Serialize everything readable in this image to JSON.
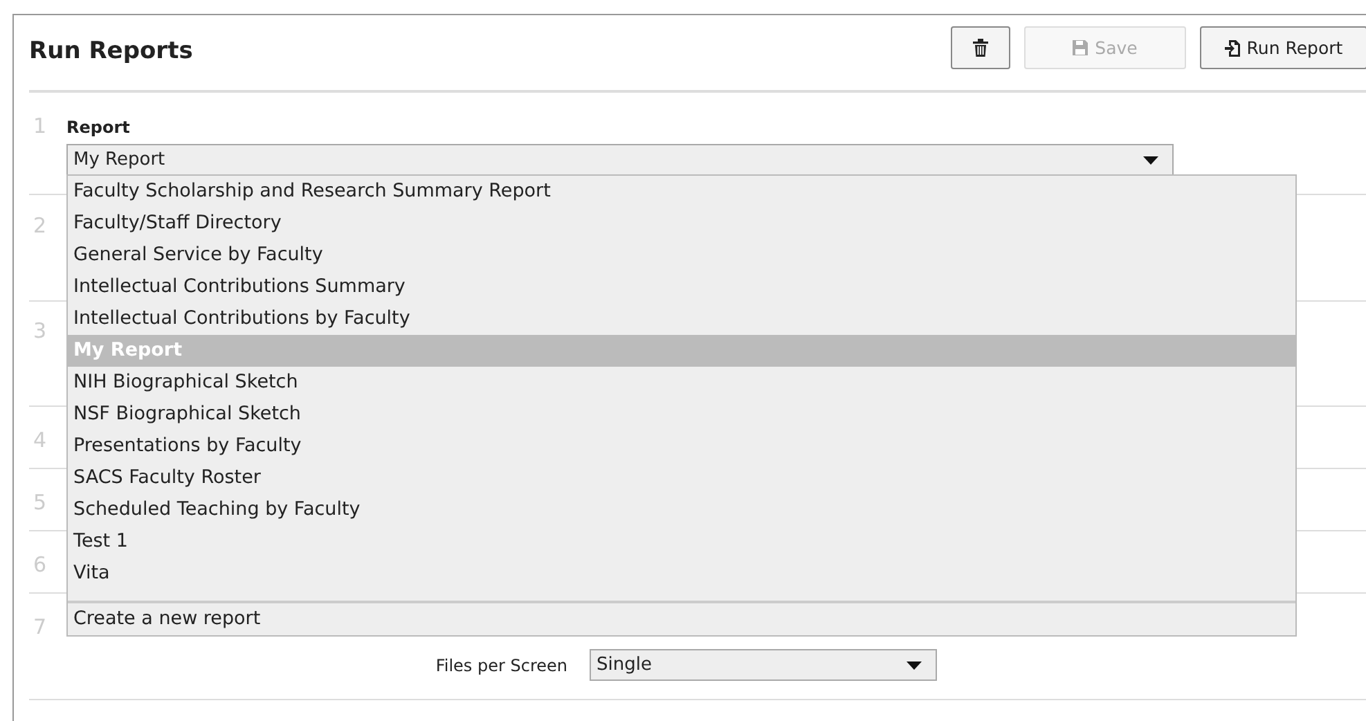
{
  "title": "Run Reports",
  "buttons": [
    {
      "kind": "delete",
      "disabled": false
    },
    {
      "kind": "save",
      "label": "Save",
      "disabled": true
    },
    {
      "kind": "run",
      "label": "Run Report",
      "disabled": false
    }
  ],
  "steps": [
    "1",
    "2",
    "3",
    "4",
    "5",
    "6",
    "7"
  ],
  "report": {
    "label": "Report",
    "value": "My Report",
    "expanded": true,
    "options": [
      {
        "label": "Faculty Scholarship and Research Summary Report",
        "selected": false
      },
      {
        "label": "Faculty/Staff Directory",
        "selected": false
      },
      {
        "label": "General Service by Faculty",
        "selected": false
      },
      {
        "label": "Intellectual Contributions Summary",
        "selected": false
      },
      {
        "label": "Intellectual Contributions by Faculty",
        "selected": false
      },
      {
        "label": "My Report",
        "selected": true
      },
      {
        "label": "NIH Biographical Sketch",
        "selected": false
      },
      {
        "label": "NSF Biographical Sketch",
        "selected": false
      },
      {
        "label": "Presentations by Faculty",
        "selected": false
      },
      {
        "label": "SACS Faculty Roster",
        "selected": false
      },
      {
        "label": "Scheduled Teaching by Faculty",
        "selected": false
      },
      {
        "label": "Test 1",
        "selected": false
      },
      {
        "label": "Vita",
        "selected": false
      }
    ],
    "footer_option": "Create a new report"
  },
  "files_per_screen": {
    "label": "Files per Screen",
    "value": "Single"
  }
}
